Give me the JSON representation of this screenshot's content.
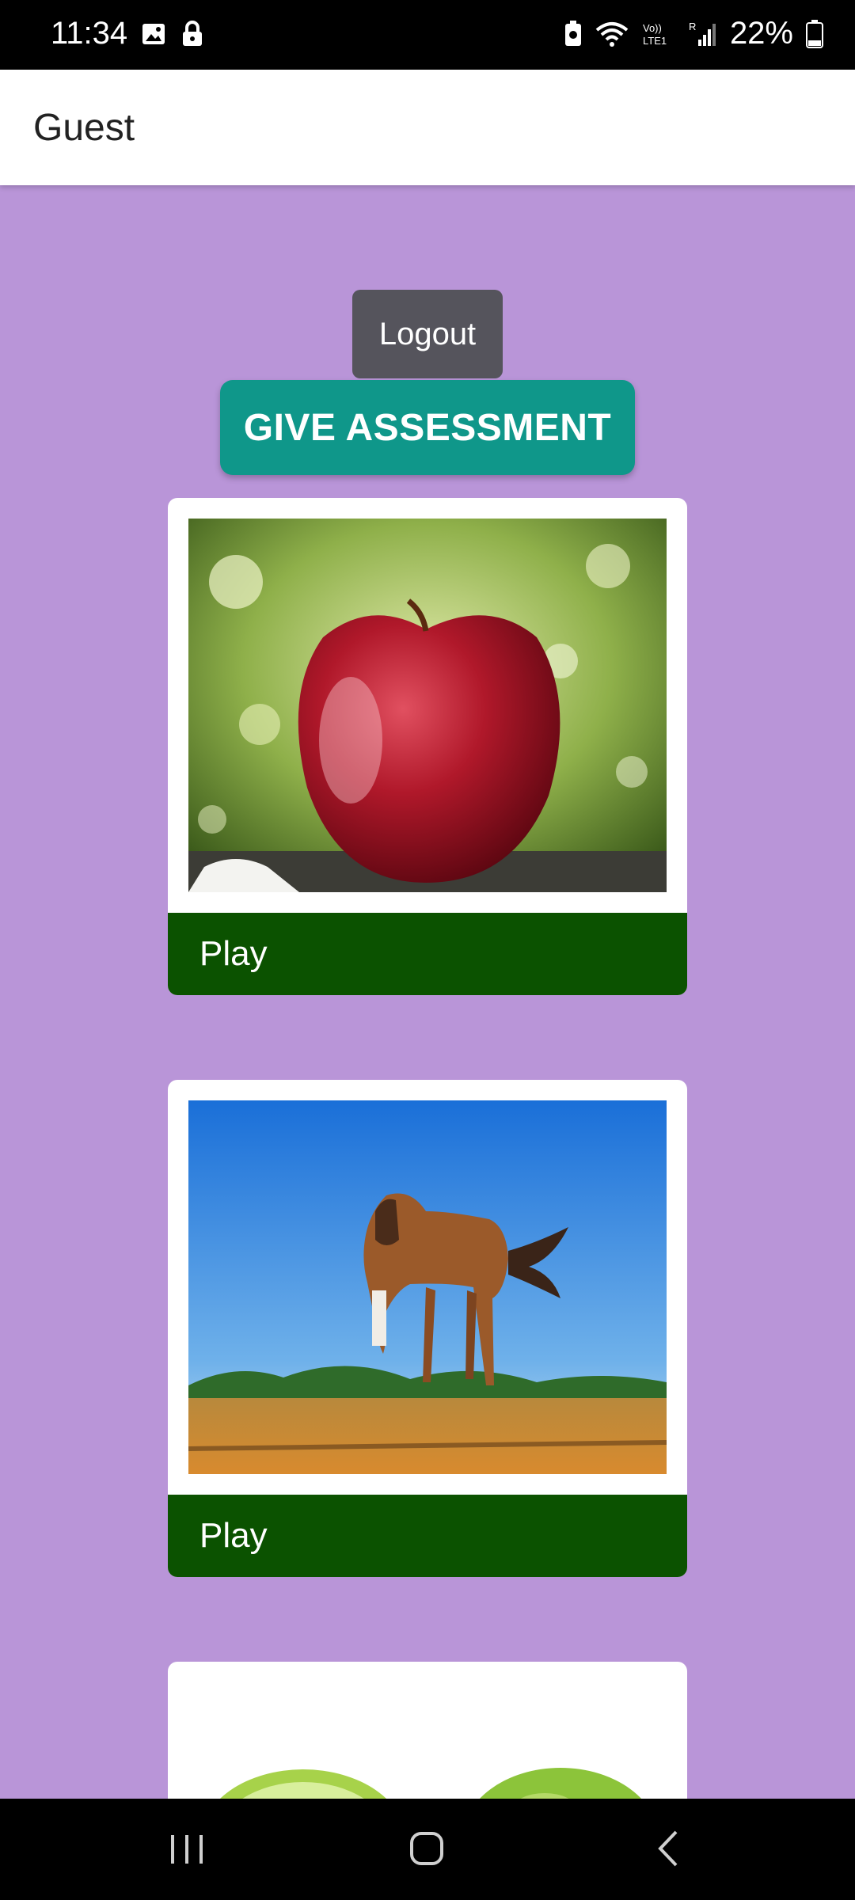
{
  "status_bar": {
    "time": "11:34",
    "battery_text": "22%",
    "icons": [
      "gallery-icon",
      "lock-icon",
      "battery-saver-icon",
      "wifi-icon",
      "volte-icon",
      "signal-icon",
      "battery-icon"
    ]
  },
  "app_bar": {
    "title": "Guest"
  },
  "actions": {
    "logout_label": "Logout",
    "assessment_label": "GIVE ASSESSMENT"
  },
  "cards": [
    {
      "image": "apple-image",
      "play_label": "Play"
    },
    {
      "image": "horse-image",
      "play_label": "Play"
    },
    {
      "image": "lime-image",
      "play_label": ""
    }
  ],
  "colors": {
    "background": "#b995d8",
    "play_bar": "#0b5200",
    "assessment_button": "#0f978a",
    "logout_button": "#55545c"
  },
  "nav_bar": {
    "buttons": [
      "recent-apps-icon",
      "home-icon",
      "back-icon"
    ]
  }
}
